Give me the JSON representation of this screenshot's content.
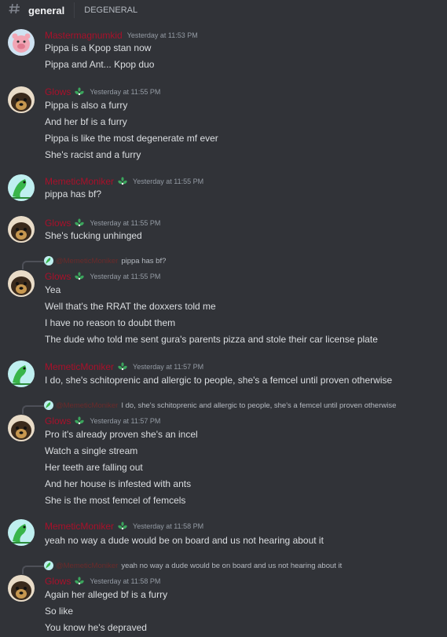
{
  "header": {
    "channel_name": "general",
    "topic": "DEGENERAL"
  },
  "colors": {
    "background": "#313338",
    "username_red": "#a9102a",
    "timestamp": "#949ba4",
    "badge_green": "#3ba55c"
  },
  "messages": [
    {
      "author": "Mastermagnumkid",
      "timestamp": "Yesterday at 11:53 PM",
      "lines": [
        "Pippa is a Kpop stan now",
        "Pippa and Ant... Kpop duo"
      ]
    },
    {
      "author": "Glows",
      "timestamp": "Yesterday at 11:55 PM",
      "lines": [
        "Pippa is also a furry",
        "And her bf is a furry",
        "Pippa is like the most degenerate mf ever",
        "She's racist and a furry"
      ]
    },
    {
      "author": "MemeticMoniker",
      "timestamp": "Yesterday at 11:55 PM",
      "lines": [
        "pippa has bf?"
      ]
    },
    {
      "author": "Glows",
      "timestamp": "Yesterday at 11:55 PM",
      "lines": [
        "She's fucking unhinged"
      ]
    },
    {
      "author": "Glows",
      "timestamp": "Yesterday at 11:55 PM",
      "reply": {
        "author": "@MemeticMoniker",
        "text": "pippa has bf?"
      },
      "lines": [
        "Yea",
        "Well that's the RRAT the doxxers told me",
        "I have no reason to doubt them",
        "The dude who told me sent gura's parents pizza and stole their car license plate"
      ]
    },
    {
      "author": "MemeticMoniker",
      "timestamp": "Yesterday at 11:57 PM",
      "lines": [
        "I do, she's schitoprenic and allergic to people, she's a femcel until proven otherwise"
      ]
    },
    {
      "author": "Glows",
      "timestamp": "Yesterday at 11:57 PM",
      "reply": {
        "author": "@MemeticMoniker",
        "text": "I do, she's schitoprenic and allergic to people, she's a femcel until proven otherwise"
      },
      "lines": [
        "Pro it's already proven she's an incel",
        "Watch a single stream",
        "Her teeth are falling out",
        "And her house is infested with ants",
        "She is the most femcel of femcels"
      ]
    },
    {
      "author": "MemeticMoniker",
      "timestamp": "Yesterday at 11:58 PM",
      "lines": [
        "yeah no way a dude would be on board and us not hearing about it"
      ]
    },
    {
      "author": "Glows",
      "timestamp": "Yesterday at 11:58 PM",
      "reply": {
        "author": "@MemeticMoniker",
        "text": "yeah no way a dude would be on board and us not hearing about it"
      },
      "lines": [
        "Again her alleged bf is a furry",
        "So like",
        "You know he's depraved"
      ]
    }
  ]
}
